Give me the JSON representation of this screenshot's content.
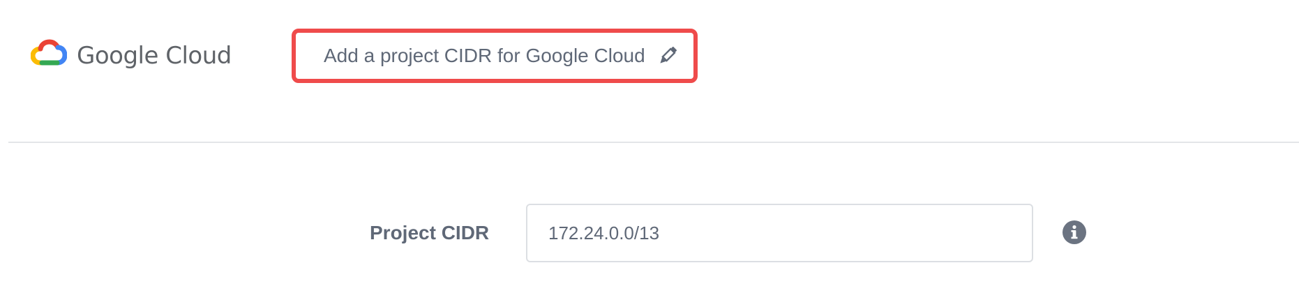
{
  "brand": {
    "name": "Google Cloud",
    "logo": "google-cloud-logo"
  },
  "header": {
    "title": "Add a project CIDR for Google Cloud",
    "edit_icon": "pencil-icon"
  },
  "form": {
    "project_cidr": {
      "label": "Project CIDR",
      "value": "172.24.0.0/13",
      "info_icon": "info-icon"
    }
  },
  "colors": {
    "highlight_border": "#ef4b4b",
    "text": "#5f6877",
    "input_border": "#dcdfe3",
    "divider": "#e3e5e8"
  }
}
